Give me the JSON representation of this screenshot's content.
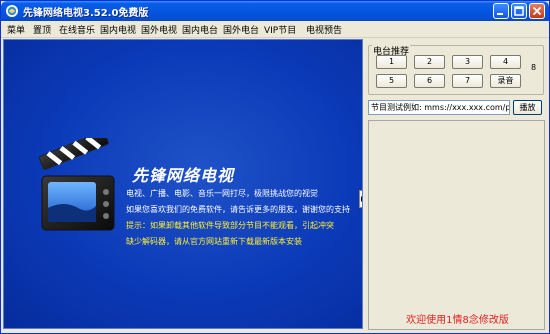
{
  "window": {
    "title": "先锋网络电视3.52.0免费版"
  },
  "menu": {
    "items": [
      "菜单",
      "置顶",
      "在线音乐",
      "国内电视",
      "国外电视",
      "国内电台",
      "国外电台",
      "VIP节目",
      "电视预告"
    ]
  },
  "main": {
    "brand_title": "先锋网络电视",
    "lines": [
      "电视、广播、电影、音乐一网打尽，极限挑战您的视觉",
      "如果您喜欢我们的免费软件，请告诉更多的朋友，谢谢您的支持",
      "提示：如果卸载其他软件导致部分节目不能观看，引起冲突",
      "缺少解码器，请从官方网站重新下载最新版本安装"
    ]
  },
  "stations": {
    "title": "电台推荐",
    "buttons": [
      "1",
      "2",
      "3",
      "4",
      "5",
      "6",
      "7",
      "录音"
    ],
    "side_label": "8"
  },
  "test": {
    "input_value": "节目测试例如: mms://xxx.xxx.com/play",
    "play_label": "播放"
  },
  "status": {
    "welcome": "欢迎使用1情8念修改版"
  },
  "colors": {
    "title_blue": "#0555e0",
    "panel_blue": "#0b3ab8",
    "tip_yellow": "#ffee33",
    "welcome_red": "#e02020"
  }
}
